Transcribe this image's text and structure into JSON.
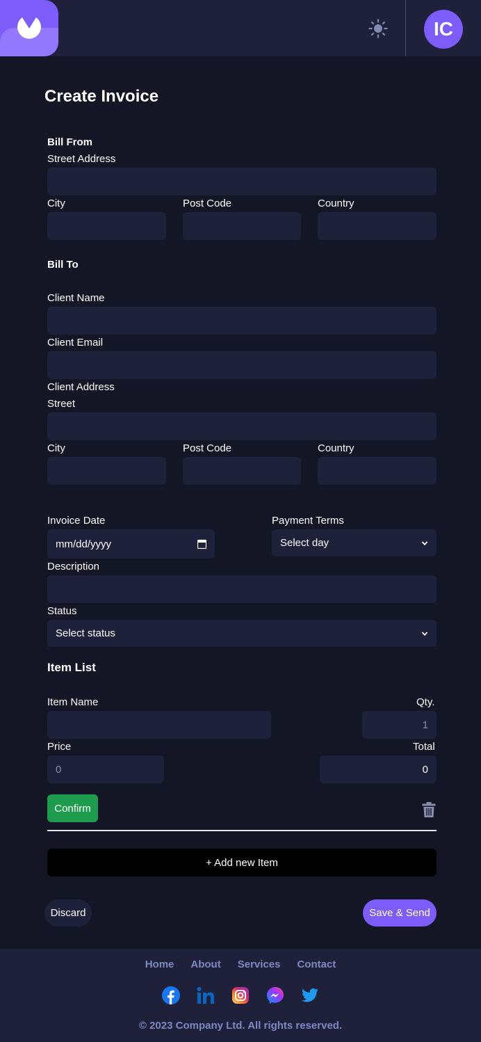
{
  "header": {
    "avatar_initials": "IC",
    "theme_icon": "sun-icon",
    "logo_icon": "brand-logo-icon"
  },
  "page": {
    "title": "Create Invoice"
  },
  "bill_from": {
    "heading": "Bill From",
    "street_label": "Street Address",
    "street_value": "",
    "city_label": "City",
    "city_value": "",
    "postcode_label": "Post Code",
    "postcode_value": "",
    "country_label": "Country",
    "country_value": ""
  },
  "bill_to": {
    "heading": "Bill To",
    "client_name_label": "Client Name",
    "client_name_value": "",
    "client_email_label": "Client Email",
    "client_email_value": "",
    "client_address_label": "Client Address",
    "street_label": "Street",
    "street_value": "",
    "city_label": "City",
    "city_value": "",
    "postcode_label": "Post Code",
    "postcode_value": "",
    "country_label": "Country",
    "country_value": ""
  },
  "invoice": {
    "date_label": "Invoice Date",
    "date_placeholder": "mm/dd/yyyy",
    "terms_label": "Payment Terms",
    "terms_selected": "Select day",
    "description_label": "Description",
    "description_value": "",
    "status_label": "Status",
    "status_selected": "Select status"
  },
  "items": {
    "heading": "Item List",
    "item_name_label": "Item Name",
    "item_name_value": "",
    "qty_label": "Qty.",
    "qty_placeholder": "1",
    "price_label": "Price",
    "price_placeholder": "0",
    "total_label": "Total",
    "total_value": "0",
    "confirm_label": "Confirm",
    "add_label": "+ Add new Item"
  },
  "actions": {
    "discard_label": "Discard",
    "save_label": "Save & Send"
  },
  "footer": {
    "links": [
      "Home",
      "About",
      "Services",
      "Contact"
    ],
    "socials": [
      "facebook-icon",
      "linkedin-icon",
      "instagram-icon",
      "messenger-icon",
      "twitter-icon"
    ],
    "copyright": "© 2023 Company Ltd. All rights reserved."
  },
  "colors": {
    "accent": "#7c5dfa",
    "background": "#141625",
    "surface": "#1e2139",
    "confirm": "#1e9c4e"
  }
}
